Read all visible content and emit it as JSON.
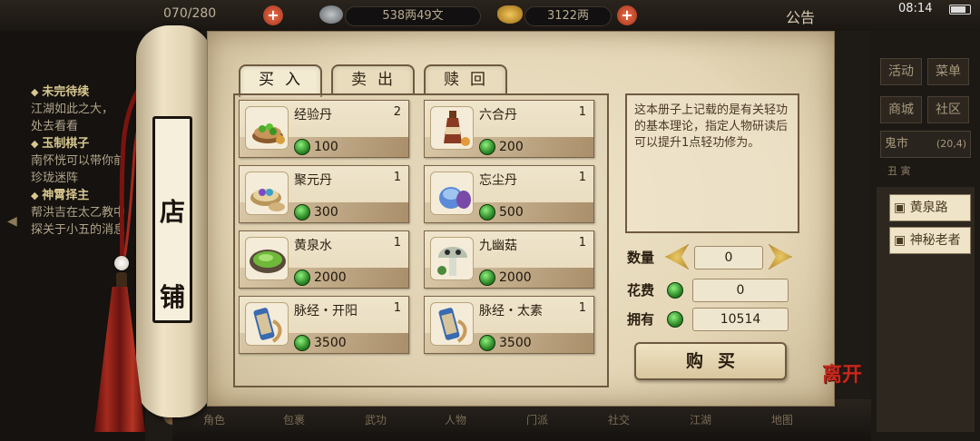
{
  "topbar": {
    "stamina": "070/280",
    "copper": "538两49文",
    "gold": "3122两",
    "announcement": "公告",
    "clock": "08:14"
  },
  "quests": [
    {
      "title": "未完待续",
      "desc": "江湖如此之大，",
      "desc2": "处去看看"
    },
    {
      "title": "玉制棋子",
      "desc": "南怀恍可以带你前",
      "desc2": "珍珑迷阵"
    },
    {
      "title": "神霄择主",
      "desc": "帮洪吉在太乙教中",
      "desc2": "探关于小五的消息"
    }
  ],
  "side_menu": {
    "activity": "活动",
    "menu": "菜单",
    "store": "商城",
    "community": "社区",
    "location": "鬼市",
    "coords": "(20,4)",
    "time": "丑 寅",
    "npc1": "黄泉路",
    "npc2": "神秘老者"
  },
  "bottom_nav": [
    "角色",
    "包裹",
    "武功",
    "人物",
    "门派",
    "社交",
    "江湖",
    "地图"
  ],
  "shop": {
    "plaque": [
      "店",
      "铺"
    ],
    "tabs": [
      "买入",
      "卖出",
      "赎回"
    ],
    "items": [
      {
        "name": "经验丹",
        "qty": "2",
        "price": "100",
        "icon": "exp-pill-icon"
      },
      {
        "name": "六合丹",
        "qty": "1",
        "price": "200",
        "icon": "liuhe-pill-icon"
      },
      {
        "name": "聚元丹",
        "qty": "1",
        "price": "300",
        "icon": "juyuan-pill-icon"
      },
      {
        "name": "忘尘丹",
        "qty": "1",
        "price": "500",
        "icon": "wangchen-pill-icon"
      },
      {
        "name": "黄泉水",
        "qty": "1",
        "price": "2000",
        "icon": "yellow-spring-water-icon"
      },
      {
        "name": "九幽菇",
        "qty": "1",
        "price": "2000",
        "icon": "jiuyou-mushroom-icon"
      },
      {
        "name": "脉经・开阳",
        "qty": "1",
        "price": "3500",
        "icon": "meridian-scroll-icon"
      },
      {
        "name": "脉经・太素",
        "qty": "1",
        "price": "3500",
        "icon": "meridian-scroll-icon"
      }
    ],
    "description": "这本册子上记载的是有关轻功的基本理论，指定人物研读后可以提升1点轻功修为。",
    "quantity_label": "数量",
    "quantity_value": "0",
    "cost_label": "花费",
    "cost_value": "0",
    "owned_label": "拥有",
    "owned_value": "10514",
    "buy_label": "购买",
    "leave_label": "离开"
  },
  "colors": {
    "jade": "#2f8a28",
    "leave": "#c4281c",
    "paper": "#e4d6b6"
  }
}
